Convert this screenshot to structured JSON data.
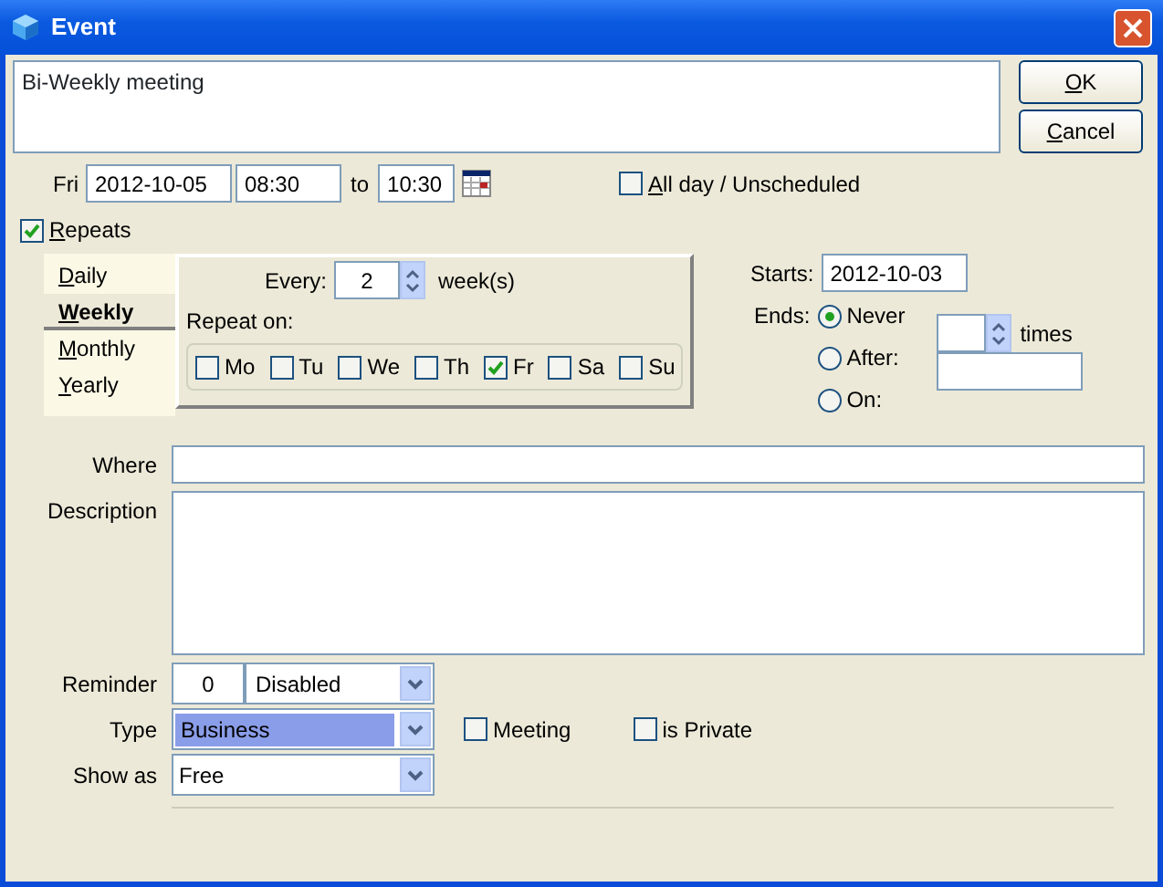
{
  "window": {
    "title": "Event"
  },
  "subject": {
    "value": "Bi-Weekly meeting"
  },
  "buttons": [
    {
      "label": "OK",
      "mnemonic": true
    },
    {
      "label": "Cancel",
      "mnemonic": true
    }
  ],
  "time": {
    "day": "Fri",
    "date": "2012-10-05",
    "start": "08:30",
    "to": "to",
    "end": "10:30"
  },
  "all_day": {
    "label": "All day / Unscheduled",
    "checked": false,
    "mnemonic": true
  },
  "repeats": {
    "label": "Repeats",
    "checked": true,
    "mnemonic": true
  },
  "frequency_tabs": [
    {
      "label": "Daily",
      "selected": false,
      "mnemonic": true
    },
    {
      "label": "Weekly",
      "selected": true,
      "mnemonic": true
    },
    {
      "label": "Monthly",
      "selected": false,
      "mnemonic": true
    },
    {
      "label": "Yearly",
      "selected": false,
      "mnemonic": true
    }
  ],
  "every": {
    "label": "Every:",
    "value": "2",
    "unit": "week(s)"
  },
  "repeat_on": {
    "label": "Repeat on:",
    "days": [
      {
        "label": "Mo",
        "checked": false
      },
      {
        "label": "Tu",
        "checked": false
      },
      {
        "label": "We",
        "checked": false
      },
      {
        "label": "Th",
        "checked": false
      },
      {
        "label": "Fr",
        "checked": true
      },
      {
        "label": "Sa",
        "checked": false
      },
      {
        "label": "Su",
        "checked": false
      }
    ]
  },
  "starts": {
    "label": "Starts:",
    "value": "2012-10-03"
  },
  "ends": {
    "label": "Ends:",
    "options": [
      {
        "label": "Never",
        "selected": true
      },
      {
        "label": "After:",
        "selected": false
      },
      {
        "label": "On:",
        "selected": false
      }
    ],
    "times_unit": "times"
  },
  "where": {
    "label": "Where"
  },
  "description": {
    "label": "Description"
  },
  "reminder": {
    "label": "Reminder",
    "value": "0",
    "unit": "Disabled"
  },
  "type": {
    "label": "Type",
    "value": "Business",
    "highlighted": true
  },
  "flags": [
    {
      "label": "Meeting",
      "checked": false
    },
    {
      "label": "is Private",
      "checked": false
    }
  ],
  "show_as": {
    "label": "Show as",
    "value": "Free"
  }
}
